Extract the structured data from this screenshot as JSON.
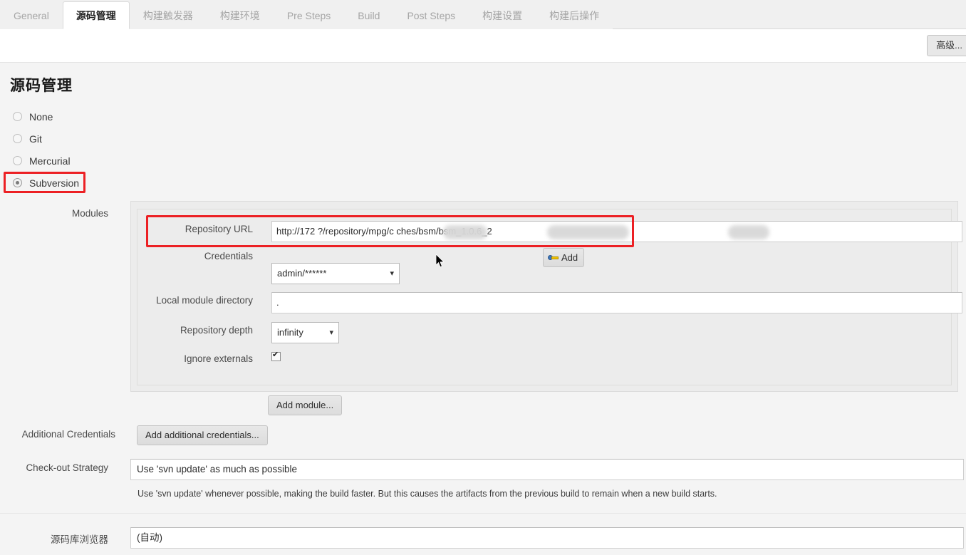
{
  "tabs": [
    {
      "label": "General",
      "active": false
    },
    {
      "label": "源码管理",
      "active": true
    },
    {
      "label": "构建触发器",
      "active": false
    },
    {
      "label": "构建环境",
      "active": false
    },
    {
      "label": "Pre Steps",
      "active": false
    },
    {
      "label": "Build",
      "active": false
    },
    {
      "label": "Post Steps",
      "active": false
    },
    {
      "label": "构建设置",
      "active": false
    },
    {
      "label": "构建后操作",
      "active": false
    }
  ],
  "toolbar": {
    "advanced_button": "高级..."
  },
  "page": {
    "title": "源码管理"
  },
  "scm_options": [
    {
      "label": "None",
      "selected": false
    },
    {
      "label": "Git",
      "selected": false
    },
    {
      "label": "Mercurial",
      "selected": false
    },
    {
      "label": "Subversion",
      "selected": true
    }
  ],
  "modules": {
    "section_label": "Modules",
    "repository_url": {
      "label": "Repository URL",
      "value": "http://172          ?/repository/mpg/c                ches/bsm/bsm_1.0.6_2"
    },
    "credentials": {
      "label": "Credentials",
      "value": "admin/******",
      "add_button": "Add"
    },
    "local_module_directory": {
      "label": "Local module directory",
      "value": "."
    },
    "repository_depth": {
      "label": "Repository depth",
      "value": "infinity"
    },
    "ignore_externals": {
      "label": "Ignore externals",
      "checked": true
    },
    "add_module_button": "Add module..."
  },
  "additional_credentials": {
    "label": "Additional Credentials",
    "button": "Add additional credentials..."
  },
  "checkout_strategy": {
    "label": "Check-out Strategy",
    "value": "Use 'svn update' as much as possible",
    "help": "Use 'svn update' whenever possible, making the build faster. But this causes the artifacts from the previous build to remain when a new build starts."
  },
  "repository_browser": {
    "label": "源码库浏览器",
    "value": "(自动)"
  },
  "colors": {
    "highlight": "#ec2024",
    "panel_bg": "#ececec",
    "page_bg": "#f4f4f4",
    "active_tab_text": "#1f1f1f",
    "inactive_tab_text": "#a5a5a5"
  }
}
